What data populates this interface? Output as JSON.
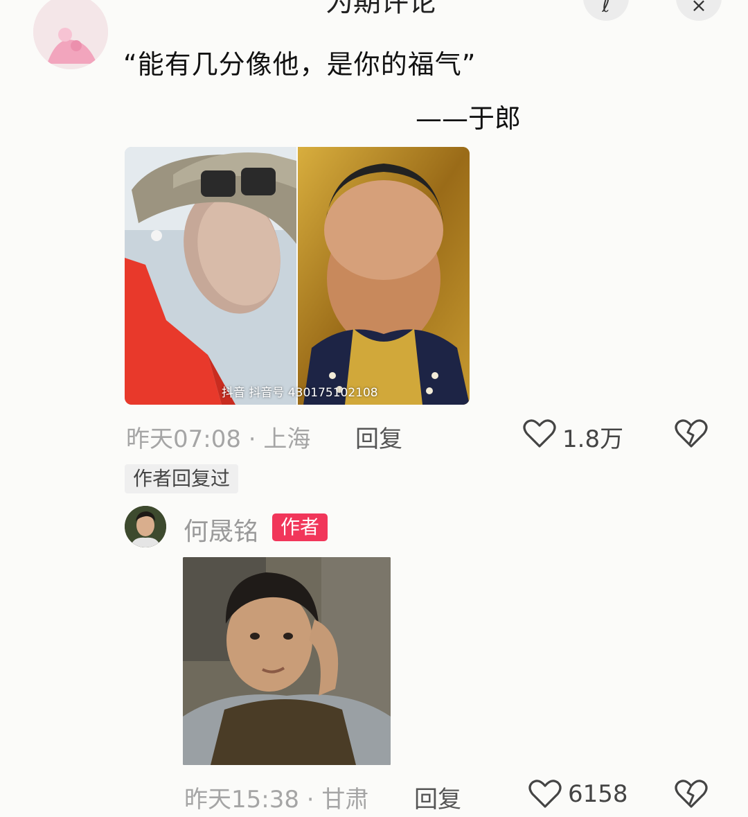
{
  "top_bar": {
    "title": "为期评论",
    "edit_icon_glyph": "ℓ",
    "close_icon_glyph": "×"
  },
  "comment1": {
    "text_line1": "“能有几分像他，是你的福气”",
    "text_line2": "——于郎",
    "image_watermark": "抖音 抖音号 430175102108",
    "time_location": "昨天07:08 · 上海",
    "reply_label": "回复",
    "likes": "1.8万",
    "author_replied_tag": "作者回复过"
  },
  "reply1": {
    "username": "何晟铭",
    "author_badge": "作者",
    "time_location": "昨天15:38 · 甘肃",
    "reply_label": "回复",
    "likes": "6158"
  },
  "colors": {
    "background": "#fbfbf9",
    "meta_gray": "#a5a5a5",
    "author_badge": "#f1365a",
    "tag_bg": "#efefef"
  },
  "icons": [
    "edit-icon",
    "close-icon",
    "heart-icon",
    "broken-heart-icon"
  ]
}
